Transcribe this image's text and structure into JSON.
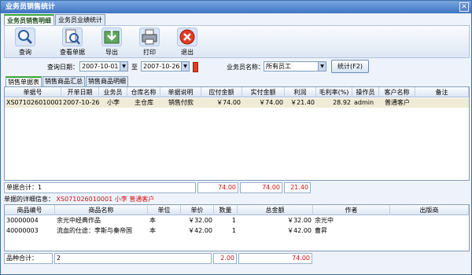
{
  "window": {
    "title": "业务员销售统计",
    "close": "✕"
  },
  "top_tabs": [
    {
      "label": "业务员销售明细",
      "active": true
    },
    {
      "label": "业务员业绩统计",
      "active": false
    }
  ],
  "toolbar": {
    "query": {
      "label": "查询",
      "icon": "magnifier-icon"
    },
    "view": {
      "label": "查看单据",
      "icon": "document-search-icon"
    },
    "export": {
      "label": "导出",
      "icon": "export-icon"
    },
    "print": {
      "label": "打印",
      "icon": "printer-icon"
    },
    "exit": {
      "label": "退出",
      "icon": "exit-icon"
    }
  },
  "filter": {
    "date_label": "查询日期：",
    "date_from": "2007-10-01",
    "to_label": "至",
    "date_to": "2007-10-26",
    "salesman_label": "业务员名称：",
    "salesman_value": "所有员工",
    "stat_button": "统计(F2)"
  },
  "sub_tabs": [
    {
      "label": "销售单据表",
      "active": true
    },
    {
      "label": "销售商品汇总",
      "active": false
    },
    {
      "label": "销售商品明细",
      "active": false
    }
  ],
  "grid1": {
    "columns": [
      "单据号",
      "开单日期",
      "业务员",
      "仓库名称",
      "单据说明",
      "应付金额",
      "实付金额",
      "利润",
      "毛利率(%)",
      "操作员",
      "客户名称",
      "备注"
    ],
    "rows": [
      [
        "XS071026010001",
        "2007-10-26",
        "小李",
        "主仓库",
        "销售付款",
        "￥74.00",
        "￥74.00",
        "￥21.40",
        "28.92",
        "admin",
        "普通客户",
        ""
      ]
    ],
    "summary_label": "单据合计：1",
    "sum_payable": "74.00",
    "sum_paid": "74.00",
    "sum_profit": "21.40"
  },
  "detail": {
    "label": "单据的详细信息：",
    "info": "XS071026010001 小李 普通客户"
  },
  "grid2": {
    "columns": [
      "商品编号",
      "商品名称",
      "单位",
      "单价",
      "数量",
      "总金额",
      "作者",
      "出版商"
    ],
    "rows": [
      [
        "30000004",
        "余光中经典作品",
        "本",
        "￥32.00",
        "1",
        "￥32.00",
        "余光中",
        ""
      ],
      [
        "40000003",
        "流血的仕途：李斯与秦帝国",
        "本",
        "￥42.00",
        "1",
        "￥42.00",
        "曹昇",
        ""
      ]
    ],
    "summary_label": "品种合计：",
    "summary_count": "2",
    "sum_qty": "2.00",
    "sum_amount": "74.00"
  },
  "colors": {
    "accent_green": "#3aa33a",
    "title_blue": "#3f74c2",
    "total_red": "#d01010"
  }
}
